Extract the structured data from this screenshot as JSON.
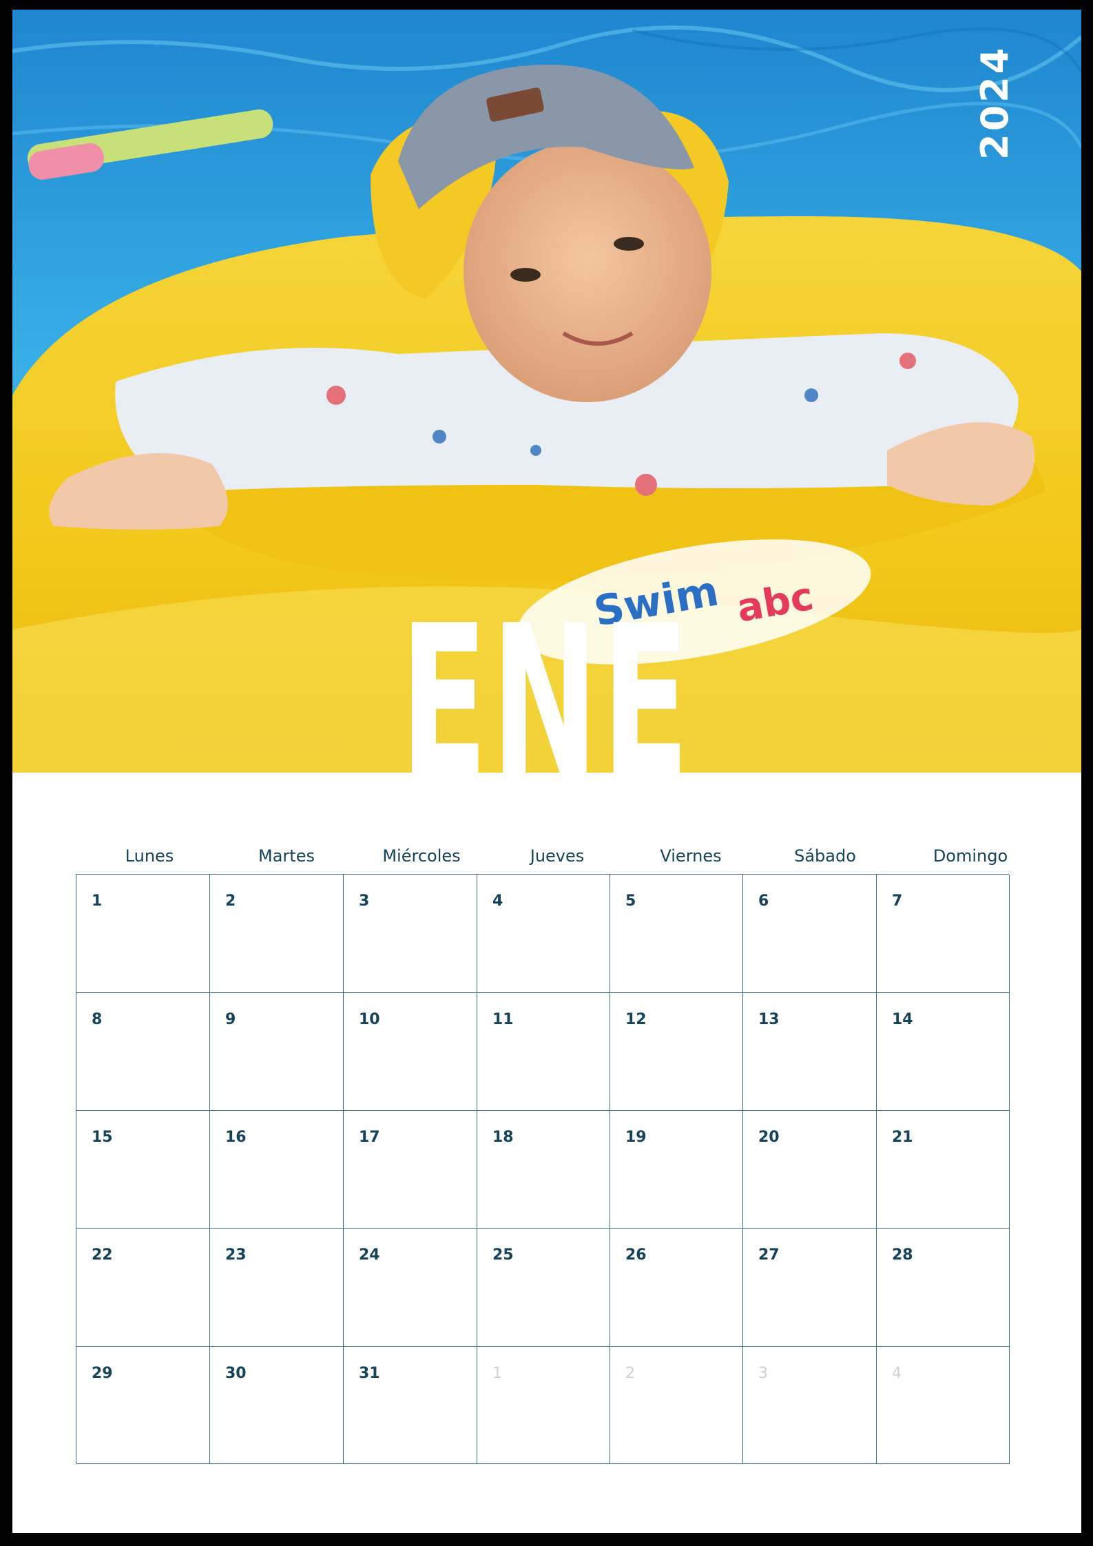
{
  "calendar": {
    "year": "2024",
    "month": "ENERO",
    "weekdays": [
      "Lunes",
      "Martes",
      "Miércoles",
      "Jueves",
      "Viernes",
      "Sábado",
      "Domingo"
    ],
    "weeks": [
      [
        {
          "day": "1"
        },
        {
          "day": "2"
        },
        {
          "day": "3"
        },
        {
          "day": "4"
        },
        {
          "day": "5"
        },
        {
          "day": "6"
        },
        {
          "day": "7"
        }
      ],
      [
        {
          "day": "8"
        },
        {
          "day": "9"
        },
        {
          "day": "10"
        },
        {
          "day": "11"
        },
        {
          "day": "12"
        },
        {
          "day": "13"
        },
        {
          "day": "14"
        }
      ],
      [
        {
          "day": "15"
        },
        {
          "day": "16"
        },
        {
          "day": "17"
        },
        {
          "day": "18"
        },
        {
          "day": "19"
        },
        {
          "day": "20"
        },
        {
          "day": "21"
        }
      ],
      [
        {
          "day": "22"
        },
        {
          "day": "23"
        },
        {
          "day": "24"
        },
        {
          "day": "25"
        },
        {
          "day": "26"
        },
        {
          "day": "27"
        },
        {
          "day": "28"
        }
      ],
      [
        {
          "day": "29"
        },
        {
          "day": "30"
        },
        {
          "day": "31"
        },
        {
          "day": "1",
          "other_month": true
        },
        {
          "day": "2",
          "other_month": true
        },
        {
          "day": "3",
          "other_month": true
        },
        {
          "day": "4",
          "other_month": true
        }
      ]
    ]
  },
  "photo": {
    "float_brand_line1": "Swim",
    "float_brand_line2": "abc"
  },
  "colors": {
    "text": "#17435a",
    "grid_line": "#3f6a7e",
    "faded_day": "#cfcfcf",
    "frame": "#000000",
    "pool": "#2aa3dc",
    "float": "#f5d42a"
  }
}
